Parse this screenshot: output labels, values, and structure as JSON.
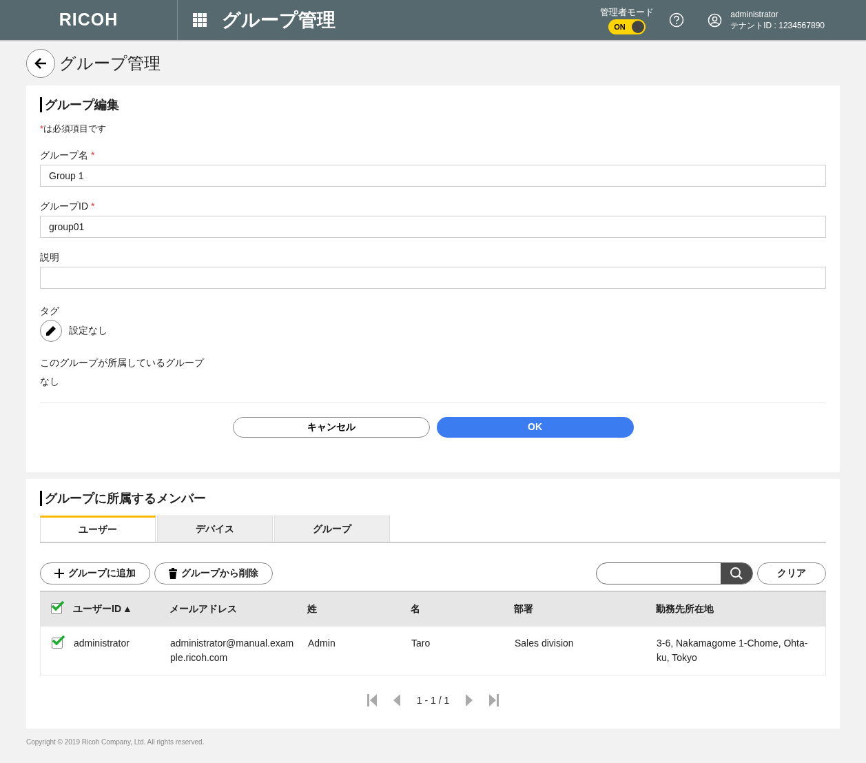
{
  "header": {
    "logo": "RICOH",
    "title": "グループ管理",
    "admin_mode": {
      "label": "管理者モード",
      "toggle_text": "ON",
      "on": true
    },
    "user": {
      "name": "administrator",
      "tenant": "テナントID : 1234567890"
    }
  },
  "page_title": "グループ管理",
  "edit": {
    "title": "グループ編集",
    "required_note": {
      "mark": "*",
      "text": "は必須項目です"
    },
    "fields": [
      {
        "label": "グループ名",
        "mark": "*",
        "value": "Group 1"
      },
      {
        "label": "グループID",
        "mark": "*",
        "value": "group01"
      },
      {
        "label": "説明"
      }
    ],
    "tag": {
      "label": "タグ",
      "value": "設定なし"
    },
    "parent_groups": {
      "label": "このグループが所属しているグループ",
      "value": "なし"
    },
    "buttons": [
      {
        "label": "キャンセル",
        "kind": "secondary"
      },
      {
        "label": "OK",
        "kind": "primary"
      }
    ]
  },
  "members": {
    "title": "グループに所属するメンバー",
    "tabs": [
      {
        "label": "ユーザー",
        "selected": true
      },
      {
        "label": "デバイス",
        "selected": false
      },
      {
        "label": "グループ",
        "selected": false
      }
    ],
    "actions": [
      {
        "label": "グループに追加",
        "kind": "add"
      },
      {
        "label": "グループから削除",
        "kind": "remove"
      }
    ],
    "clear": "クリア",
    "table": {
      "header_checked": true,
      "columns": [
        {
          "label": "ユーザーID",
          "sort": "▲"
        },
        {
          "label": "メールアドレス"
        },
        {
          "label": "姓"
        },
        {
          "label": "名"
        },
        {
          "label": "部署"
        },
        {
          "label": "勤務先所在地"
        }
      ],
      "rows": [
        {
          "checked": true,
          "cells": [
            "administrator",
            "administrator@manual.example.ricoh.com",
            "Admin",
            "Taro",
            "Sales division",
            "3-6, Nakamagome 1-Chome, Ohta-ku, Tokyo"
          ]
        }
      ]
    },
    "pagination": "1 - 1 / 1"
  },
  "footer": "Copyright © 2019 Ricoh Company, Ltd. All rights reserved."
}
